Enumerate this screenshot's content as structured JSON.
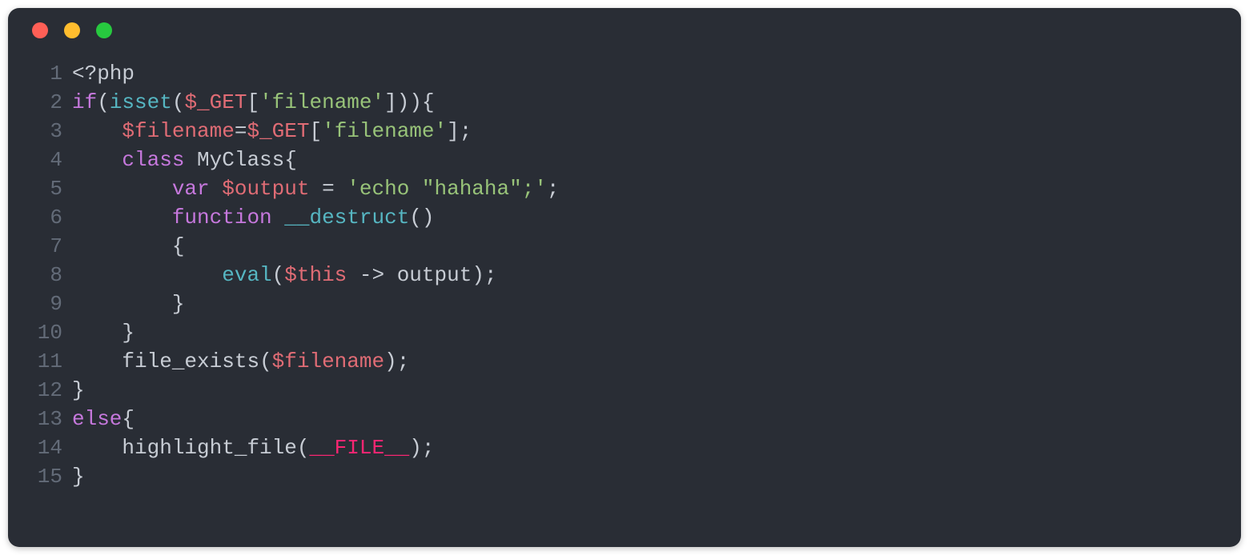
{
  "colors": {
    "window_bg": "#292d35",
    "traffic_red": "#ff5f56",
    "traffic_yellow": "#ffbd2e",
    "traffic_green": "#27c93f",
    "gutter": "#636b78",
    "default": "#c7ccd4",
    "keyword": "#c678dd",
    "func": "#56b6c2",
    "var": "#e06c75",
    "string": "#98c379",
    "magic": "#f92672"
  },
  "traffic_lights": [
    "close",
    "minimize",
    "zoom"
  ],
  "code": {
    "language": "php",
    "plain_source": "<?php\nif(isset($_GET['filename'])){\n    $filename=$_GET['filename'];\n    class MyClass{\n        var $output = 'echo \"hahaha\";';\n        function __destruct()\n        {\n            eval($this -> output);\n        }\n    }\n    file_exists($filename);\n}\nelse{\n    highlight_file(__FILE__);\n}",
    "lines": [
      {
        "n": "1",
        "tokens": [
          {
            "t": "<?php",
            "c": "tk-open"
          }
        ]
      },
      {
        "n": "2",
        "tokens": [
          {
            "t": "if",
            "c": "tk-keyword"
          },
          {
            "t": "(",
            "c": "tk-punct"
          },
          {
            "t": "isset",
            "c": "tk-func"
          },
          {
            "t": "(",
            "c": "tk-punct"
          },
          {
            "t": "$_GET",
            "c": "tk-var"
          },
          {
            "t": "[",
            "c": "tk-punct"
          },
          {
            "t": "'filename'",
            "c": "tk-string"
          },
          {
            "t": "]",
            "c": "tk-punct"
          },
          {
            "t": ")",
            "c": "tk-punct"
          },
          {
            "t": ")",
            "c": "tk-punct"
          },
          {
            "t": "{",
            "c": "tk-punct"
          }
        ]
      },
      {
        "n": "3",
        "tokens": [
          {
            "t": "    ",
            "c": "tk-default"
          },
          {
            "t": "$filename",
            "c": "tk-var"
          },
          {
            "t": "=",
            "c": "tk-punct"
          },
          {
            "t": "$_GET",
            "c": "tk-var"
          },
          {
            "t": "[",
            "c": "tk-punct"
          },
          {
            "t": "'filename'",
            "c": "tk-string"
          },
          {
            "t": "]",
            "c": "tk-punct"
          },
          {
            "t": ";",
            "c": "tk-punct"
          }
        ]
      },
      {
        "n": "4",
        "tokens": [
          {
            "t": "    ",
            "c": "tk-default"
          },
          {
            "t": "class",
            "c": "tk-keyword"
          },
          {
            "t": " ",
            "c": "tk-default"
          },
          {
            "t": "MyClass",
            "c": "tk-default"
          },
          {
            "t": "{",
            "c": "tk-punct"
          }
        ]
      },
      {
        "n": "5",
        "tokens": [
          {
            "t": "        ",
            "c": "tk-default"
          },
          {
            "t": "var",
            "c": "tk-keyword"
          },
          {
            "t": " ",
            "c": "tk-default"
          },
          {
            "t": "$output",
            "c": "tk-var"
          },
          {
            "t": " = ",
            "c": "tk-punct"
          },
          {
            "t": "'echo \"hahaha\";'",
            "c": "tk-string"
          },
          {
            "t": ";",
            "c": "tk-punct"
          }
        ]
      },
      {
        "n": "6",
        "tokens": [
          {
            "t": "        ",
            "c": "tk-default"
          },
          {
            "t": "function",
            "c": "tk-keyword"
          },
          {
            "t": " ",
            "c": "tk-default"
          },
          {
            "t": "__destruct",
            "c": "tk-func"
          },
          {
            "t": "(",
            "c": "tk-punct"
          },
          {
            "t": ")",
            "c": "tk-punct"
          }
        ]
      },
      {
        "n": "7",
        "tokens": [
          {
            "t": "        ",
            "c": "tk-default"
          },
          {
            "t": "{",
            "c": "tk-punct"
          }
        ]
      },
      {
        "n": "8",
        "tokens": [
          {
            "t": "            ",
            "c": "tk-default"
          },
          {
            "t": "eval",
            "c": "tk-func"
          },
          {
            "t": "(",
            "c": "tk-punct"
          },
          {
            "t": "$this",
            "c": "tk-var"
          },
          {
            "t": " -> ",
            "c": "tk-punct"
          },
          {
            "t": "output",
            "c": "tk-default"
          },
          {
            "t": ")",
            "c": "tk-punct"
          },
          {
            "t": ";",
            "c": "tk-punct"
          }
        ]
      },
      {
        "n": "9",
        "tokens": [
          {
            "t": "        ",
            "c": "tk-default"
          },
          {
            "t": "}",
            "c": "tk-punct"
          }
        ]
      },
      {
        "n": "10",
        "tokens": [
          {
            "t": "    ",
            "c": "tk-default"
          },
          {
            "t": "}",
            "c": "tk-punct"
          }
        ]
      },
      {
        "n": "11",
        "tokens": [
          {
            "t": "    ",
            "c": "tk-default"
          },
          {
            "t": "file_exists",
            "c": "tk-default"
          },
          {
            "t": "(",
            "c": "tk-punct"
          },
          {
            "t": "$filename",
            "c": "tk-var"
          },
          {
            "t": ")",
            "c": "tk-punct"
          },
          {
            "t": ";",
            "c": "tk-punct"
          }
        ]
      },
      {
        "n": "12",
        "tokens": [
          {
            "t": "}",
            "c": "tk-punct"
          }
        ]
      },
      {
        "n": "13",
        "tokens": [
          {
            "t": "else",
            "c": "tk-keyword"
          },
          {
            "t": "{",
            "c": "tk-punct"
          }
        ]
      },
      {
        "n": "14",
        "tokens": [
          {
            "t": "    ",
            "c": "tk-default"
          },
          {
            "t": "highlight_file",
            "c": "tk-default"
          },
          {
            "t": "(",
            "c": "tk-punct"
          },
          {
            "t": "__FILE__",
            "c": "tk-magic"
          },
          {
            "t": ")",
            "c": "tk-punct"
          },
          {
            "t": ";",
            "c": "tk-punct"
          }
        ]
      },
      {
        "n": "15",
        "tokens": [
          {
            "t": "}",
            "c": "tk-punct"
          }
        ]
      }
    ]
  }
}
